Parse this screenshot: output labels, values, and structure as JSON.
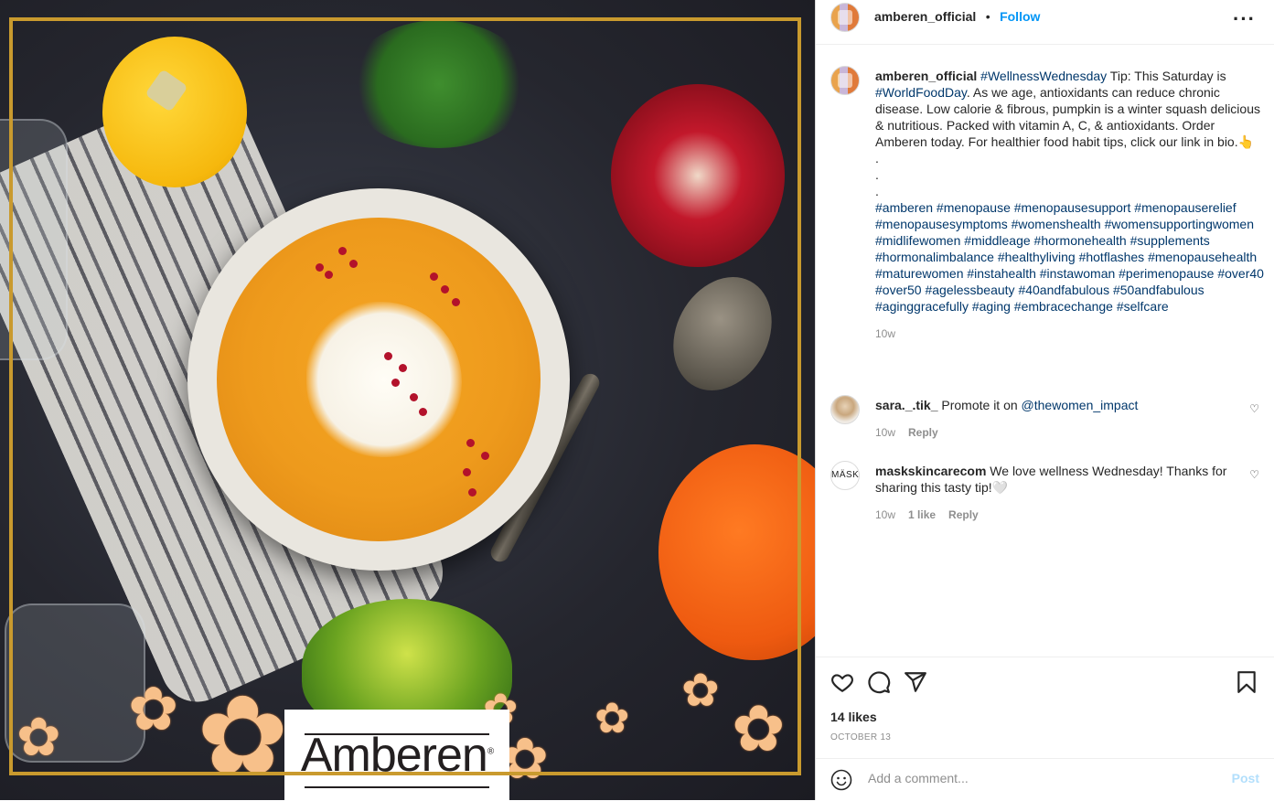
{
  "post": {
    "username": "amberen_official",
    "follow_label": "Follow",
    "separator": "•",
    "more_icon": "more-horizontal-icon"
  },
  "caption": {
    "username": "amberen_official",
    "hashtag1": "#WellnessWednesday",
    "text1": " Tip: This Saturday is ",
    "hashtag2": "#WorldFoodDay",
    "text2": ". As we age, antioxidants can reduce chronic disease. Low calorie & fibrous, pumpkin is a winter squash delicious & nutritious. Packed with vitamin A, C, & antioxidants. Order Amberen today. For healthier food habit tips, click our link in bio.👆",
    "dots": [
      ".",
      ".",
      "."
    ],
    "tags": "#amberen #menopause #menopausesupport #menopauserelief #menopausesymptoms #womenshealth #womensupportingwomen #midlifewomen #middleage #hormonehealth #supplements #hormonalimbalance #healthyliving #hotflashes #menopausehealth #maturewomen #instahealth #instawoman #perimenopause #over40 #over50 #agelessbeauty #40andfabulous #50andfabulous #aginggracefully #aging #embracechange #selfcare",
    "time": "10w"
  },
  "comments": [
    {
      "username": "sara._.tik_",
      "text": " Promote it on ",
      "mention": "@thewomen_impact",
      "time": "10w",
      "likes": "",
      "reply": "Reply"
    },
    {
      "username": "maskskincarecom",
      "text": " We love wellness Wednesday! Thanks for sharing this tasty tip!🤍",
      "mention": "",
      "time": "10w",
      "likes": "1 like",
      "reply": "Reply"
    }
  ],
  "avatar_mask_text": "MÄSK",
  "image": {
    "logo_text": "Amberen",
    "logo_mark": "®"
  },
  "actions": {
    "likes": "14 likes",
    "date": "OCTOBER 13"
  },
  "composer": {
    "placeholder": "Add a comment...",
    "post_label": "Post"
  },
  "colors": {
    "link": "#00376b",
    "follow": "#0095f6",
    "frame_gold": "#c99a2e",
    "soup_orange": "#f5a623"
  }
}
